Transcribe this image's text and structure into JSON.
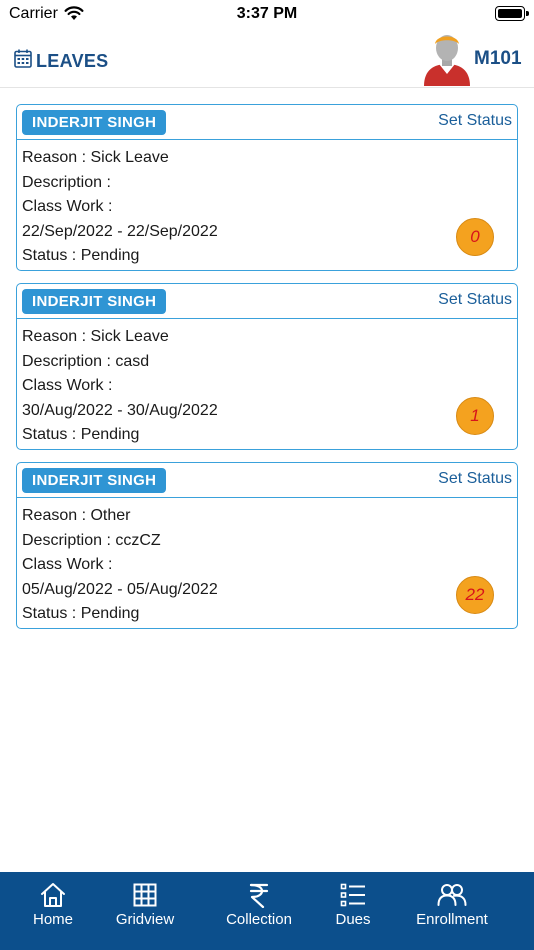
{
  "status_bar": {
    "carrier": "Carrier",
    "time": "3:37 PM"
  },
  "header": {
    "title": "LEAVES",
    "user_code": "M101"
  },
  "leaves": [
    {
      "name": "INDERJIT SINGH",
      "set_status": "Set Status",
      "reason": "Reason : Sick Leave",
      "description": "Description :",
      "class_work": "Class Work :",
      "dates": "22/Sep/2022 - 22/Sep/2022",
      "status": "Status : Pending",
      "count": "0"
    },
    {
      "name": "INDERJIT SINGH",
      "set_status": "Set Status",
      "reason": "Reason : Sick Leave",
      "description": "Description : casd",
      "class_work": "Class Work :",
      "dates": "30/Aug/2022 - 30/Aug/2022",
      "status": "Status : Pending",
      "count": "1"
    },
    {
      "name": "INDERJIT SINGH",
      "set_status": "Set Status",
      "reason": "Reason : Other",
      "description": "Description : cczCZ",
      "class_work": "Class Work :",
      "dates": "05/Aug/2022 - 05/Aug/2022",
      "status": "Status : Pending",
      "count": "22"
    }
  ],
  "bottom_nav": {
    "items": [
      {
        "label": "Home",
        "icon": "home-icon"
      },
      {
        "label": "Gridview",
        "icon": "grid-icon"
      },
      {
        "label": "Collection",
        "icon": "rupee-icon"
      },
      {
        "label": "Dues",
        "icon": "list-icon"
      },
      {
        "label": "Enrollment",
        "icon": "users-icon"
      }
    ]
  },
  "colors": {
    "primary": "#0c4f8c",
    "accent": "#2f95d4",
    "badge": "#f4a21f",
    "badge_text": "#d8141a"
  }
}
